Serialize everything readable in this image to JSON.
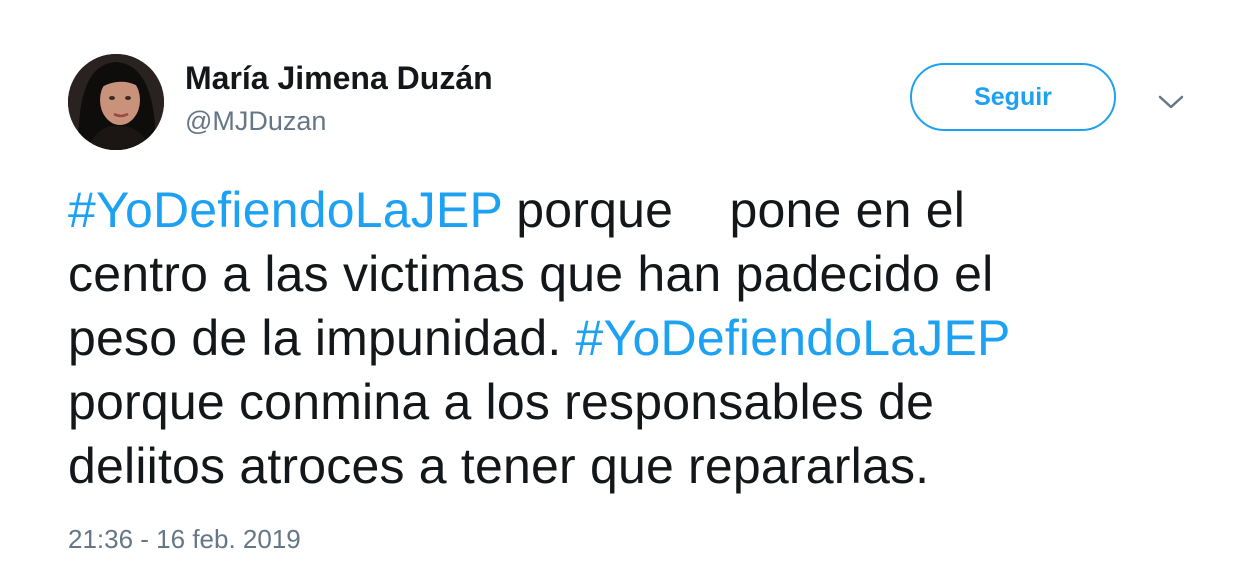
{
  "author": {
    "display_name": "María Jimena Duzán",
    "handle": "@MJDuzan"
  },
  "follow_button": {
    "label": "Seguir"
  },
  "menu": {
    "icon": "chevron-down-icon"
  },
  "tweet": {
    "line1": {
      "hashtag": "#YoDefiendoLaJEP",
      "text": " porque    pone en el"
    },
    "line2": {
      "text": "centro a las victimas que han padecido el"
    },
    "line3": {
      "text": "peso de la impunidad. ",
      "hashtag": "#YoDefiendoLaJEP"
    },
    "line4": {
      "text": "porque conmina a los responsables de"
    },
    "line5": {
      "text": "deliitos atroces a tener que repararlas."
    }
  },
  "timestamp": "21:36 - 16 feb. 2019",
  "colors": {
    "accent": "#1da1f2",
    "text": "#14171a",
    "secondary": "#657786"
  }
}
